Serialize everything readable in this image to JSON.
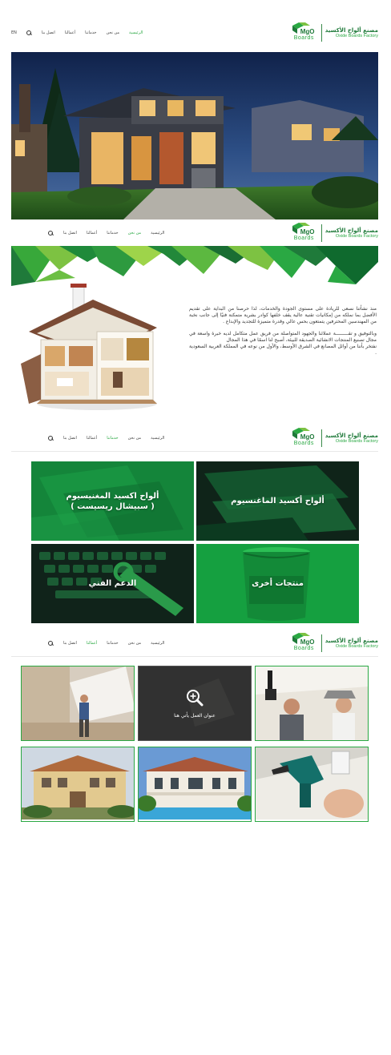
{
  "nav": {
    "home": "الرئيسية",
    "about": "من نحن",
    "services": "خدماتنا",
    "works": "أعمالنا",
    "contact": "اتصل بنا",
    "lang": "EN"
  },
  "logo": {
    "mark_text": "MgO",
    "boards": "Boards",
    "name_ar": "مصنع ألواح الأكسيد",
    "name_en": "Oxide Boards Factory"
  },
  "about": {
    "paragraph1": "منذ نشأتنا نسعى للريادة على مستوى الجودة والخدمات، لذا حرصنا من البداية على تقديم الأفضل بما نملكه من إمكانيات تقنية عالية يقف خلفها كوادر بشرية متمكنة فنيًا إلى جانب نخبة من المهندسين المحترفين يتمتعون بحس عالي وقدرة متميزة للتجديد والإبداع .",
    "paragraph2": "وبالتوفيق و تقـــــــــة عملائنا والجهود المتواصلة من فريق عمل متكامل لديه خبرة واسعة في مجال تصنيع المنتجات الانشائية الصديقة للبيئة، أصبح لنا اسمًا في هذا المجال",
    "paragraph3": "نفتخر بأننا من أوائل المصانع في الشرق الأوسط، والأول من نوعه في المملكة العربية السعودية ."
  },
  "services": {
    "mgo_boards": "ألواح أكسيد الماغنسيوم",
    "special_boards_line1": "ألواح اكسيد المغنيسيوم",
    "special_boards_line2": "( سبيشال ريسيست )",
    "other_products": "منتجات أخرى",
    "tech_support": "الدعم الفني"
  },
  "gallery": {
    "overlay_caption": "عنوان العمل يأتي هنا"
  },
  "colors": {
    "brand_green": "#2aa843",
    "dark_green": "#1f7a3a",
    "tile_green": "#148a3c"
  }
}
